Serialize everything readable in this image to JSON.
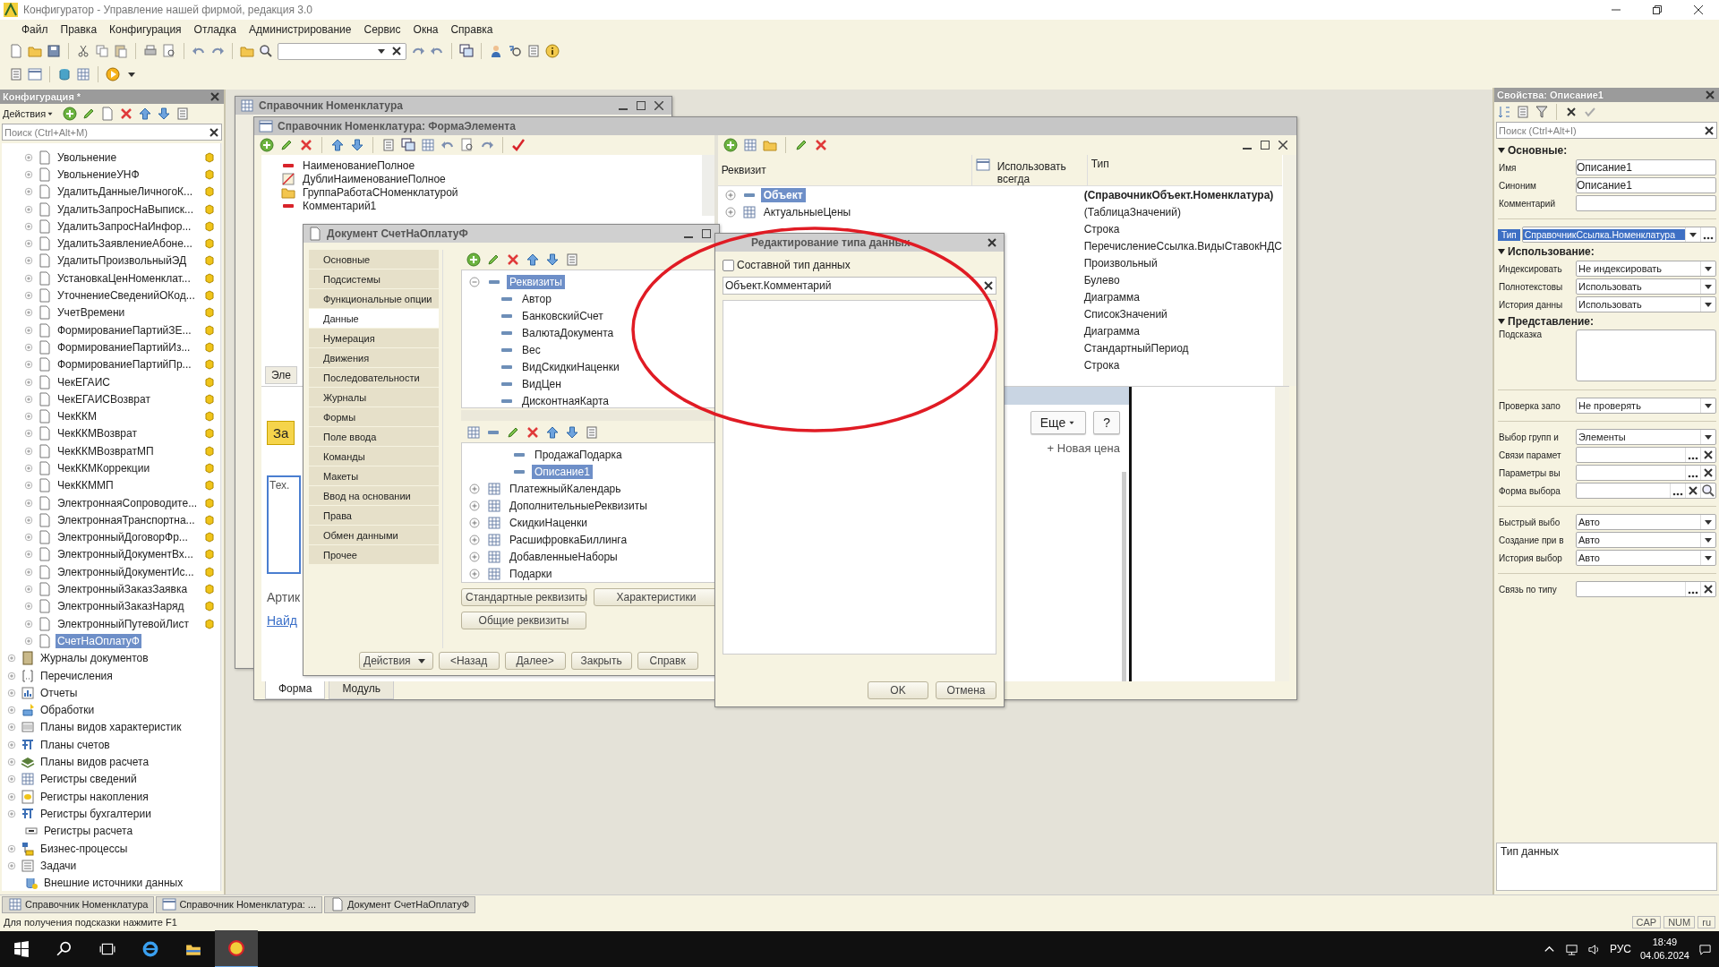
{
  "window": {
    "title": "Конфигуратор - Управление нашей фирмой, редакция 3.0"
  },
  "menu": [
    "Файл",
    "Правка",
    "Конфигурация",
    "Отладка",
    "Администрирование",
    "Сервис",
    "Окна",
    "Справка"
  ],
  "config": {
    "title": "Конфигурация *",
    "actions_label": "Действия",
    "search_placeholder": "Поиск (Ctrl+Alt+M)",
    "documents": [
      {
        "label": "Увольнение",
        "selected": false,
        "locked": true
      },
      {
        "label": "УвольнениеУНФ",
        "selected": false,
        "locked": true
      },
      {
        "label": "УдалитьДанныеЛичногоК...",
        "selected": false,
        "locked": true
      },
      {
        "label": "УдалитьЗапросНаВыписк...",
        "selected": false,
        "locked": true
      },
      {
        "label": "УдалитьЗапросНаИнфор...",
        "selected": false,
        "locked": true
      },
      {
        "label": "УдалитьЗаявлениеАбоне...",
        "selected": false,
        "locked": true
      },
      {
        "label": "УдалитьПроизвольныйЭД",
        "selected": false,
        "locked": true
      },
      {
        "label": "УстановкаЦенНоменклат...",
        "selected": false,
        "locked": true
      },
      {
        "label": "УточнениеСведенийОКод...",
        "selected": false,
        "locked": true
      },
      {
        "label": "УчетВремени",
        "selected": false,
        "locked": true
      },
      {
        "label": "ФормированиеПартийЗЕ...",
        "selected": false,
        "locked": true
      },
      {
        "label": "ФормированиеПартийИз...",
        "selected": false,
        "locked": true
      },
      {
        "label": "ФормированиеПартийПр...",
        "selected": false,
        "locked": true
      },
      {
        "label": "ЧекЕГАИС",
        "selected": false,
        "locked": true
      },
      {
        "label": "ЧекЕГАИСВозврат",
        "selected": false,
        "locked": true
      },
      {
        "label": "ЧекККМ",
        "selected": false,
        "locked": true
      },
      {
        "label": "ЧекККМВозврат",
        "selected": false,
        "locked": true
      },
      {
        "label": "ЧекККМВозвратМП",
        "selected": false,
        "locked": true
      },
      {
        "label": "ЧекККМКоррекции",
        "selected": false,
        "locked": true
      },
      {
        "label": "ЧекККММП",
        "selected": false,
        "locked": true
      },
      {
        "label": "ЭлектроннаяСопроводите...",
        "selected": false,
        "locked": true
      },
      {
        "label": "ЭлектроннаяТранспортна...",
        "selected": false,
        "locked": true
      },
      {
        "label": "ЭлектронныйДоговорФр...",
        "selected": false,
        "locked": true
      },
      {
        "label": "ЭлектронныйДокументВх...",
        "selected": false,
        "locked": true
      },
      {
        "label": "ЭлектронныйДокументИс...",
        "selected": false,
        "locked": true
      },
      {
        "label": "ЭлектронныйЗаказЗаявка",
        "selected": false,
        "locked": true
      },
      {
        "label": "ЭлектронныйЗаказНаряд",
        "selected": false,
        "locked": true
      },
      {
        "label": "ЭлектронныйПутевойЛист",
        "selected": false,
        "locked": true
      },
      {
        "label": "СчетНаОплатуФ",
        "selected": true,
        "locked": false
      }
    ],
    "sections": [
      {
        "label": "Журналы документов",
        "expandable": true
      },
      {
        "label": "Перечисления",
        "expandable": true
      },
      {
        "label": "Отчеты",
        "expandable": true
      },
      {
        "label": "Обработки",
        "expandable": true
      },
      {
        "label": "Планы видов характеристик",
        "expandable": true
      },
      {
        "label": "Планы счетов",
        "expandable": true
      },
      {
        "label": "Планы видов расчета",
        "expandable": true
      },
      {
        "label": "Регистры сведений",
        "expandable": true
      },
      {
        "label": "Регистры накопления",
        "expandable": true
      },
      {
        "label": "Регистры бухгалтерии",
        "expandable": true
      },
      {
        "label": "Регистры расчета",
        "expandable": false
      },
      {
        "label": "Бизнес-процессы",
        "expandable": true
      },
      {
        "label": "Задачи",
        "expandable": true
      },
      {
        "label": "Внешние источники данных",
        "expandable": false
      }
    ]
  },
  "catalog_window": {
    "title": "Справочник Номенклатура"
  },
  "element_form": {
    "title": "Справочник Номенклатура: ФормаЭлемента",
    "items": [
      {
        "label": "НаименованиеПолное",
        "kind": "attribute"
      },
      {
        "label": "ДублиНаименованиеПолное",
        "kind": "picture"
      },
      {
        "label": "ГруппаРаботаСНоменклатурой",
        "kind": "group"
      },
      {
        "label": "Комментарий1",
        "kind": "attribute"
      }
    ],
    "tab_label": "Эле",
    "attributes": {
      "columns": [
        "Реквизит",
        "Использовать всегда",
        "Тип"
      ],
      "rows": [
        {
          "name": "Объект",
          "kind": "attribute",
          "selected": true,
          "type": "(СправочникОбъект.Номенклатура)"
        },
        {
          "name": "АктуальныеЦены",
          "kind": "table",
          "selected": false,
          "type": "(ТаблицаЗначений)"
        },
        {
          "selected": false,
          "type": "Строка"
        },
        {
          "selected": false,
          "type": "ПеречислениеСсылка.ВидыСтавокНДС"
        },
        {
          "selected": false,
          "type": "Произвольный"
        },
        {
          "selected": false,
          "type": "Булево"
        },
        {
          "selected": false,
          "type": "Диаграмма"
        },
        {
          "selected": false,
          "type": "СписокЗначений"
        },
        {
          "selected": false,
          "type": "Диаграмма"
        },
        {
          "selected": false,
          "type": "СтандартныйПериод"
        },
        {
          "selected": false,
          "type": "Строка"
        }
      ]
    },
    "preview": {
      "button_label": "За",
      "field_label": "Тех.",
      "label": "Артик",
      "link": "Найд",
      "more_button": "Еще",
      "help_button": "?",
      "add_link": "+ Новая цена"
    },
    "bottom_tabs": [
      {
        "label": "Форма",
        "selected": true
      },
      {
        "label": "Модуль",
        "selected": false
      }
    ]
  },
  "document_window": {
    "title": "Документ СчетНаОплатуФ",
    "nav": [
      {
        "label": "Основные",
        "selected": false
      },
      {
        "label": "Подсистемы",
        "selected": false
      },
      {
        "label": "Функциональные опции",
        "selected": false
      },
      {
        "label": "Данные",
        "selected": true
      },
      {
        "label": "Нумерация",
        "selected": false
      },
      {
        "label": "Движения",
        "selected": false
      },
      {
        "label": "Последовательности",
        "selected": false
      },
      {
        "label": "Журналы",
        "selected": false
      },
      {
        "label": "Формы",
        "selected": false
      },
      {
        "label": "Поле ввода",
        "selected": false
      },
      {
        "label": "Команды",
        "selected": false
      },
      {
        "label": "Макеты",
        "selected": false
      },
      {
        "label": "Ввод на основании",
        "selected": false
      },
      {
        "label": "Права",
        "selected": false
      },
      {
        "label": "Обмен данными",
        "selected": false
      },
      {
        "label": "Прочее",
        "selected": false
      }
    ],
    "attributes_tree": [
      {
        "label": "Реквизиты",
        "selected": true,
        "expanded": true,
        "children": [
          {
            "label": "Автор"
          },
          {
            "label": "БанковскийСчет"
          },
          {
            "label": "ВалютаДокумента"
          },
          {
            "label": "Вес"
          },
          {
            "label": "ВидСкидкиНаценки"
          },
          {
            "label": "ВидЦен"
          },
          {
            "label": "ДисконтнаяКарта"
          }
        ]
      }
    ],
    "tables_tree": [
      {
        "label": "ПродажаПодарка",
        "kind": "attribute",
        "selected": false
      },
      {
        "label": "Описание1",
        "kind": "attribute",
        "selected": true
      },
      {
        "label": "ПлатежныйКалендарь",
        "kind": "table",
        "selected": false
      },
      {
        "label": "ДополнительныеРеквизиты",
        "kind": "table",
        "selected": false
      },
      {
        "label": "СкидкиНаценки",
        "kind": "table",
        "selected": false
      },
      {
        "label": "РасшифровкаБиллинга",
        "kind": "table",
        "selected": false
      },
      {
        "label": "ДобавленныеНаборы",
        "kind": "table",
        "selected": false
      },
      {
        "label": "Подарки",
        "kind": "table",
        "selected": false
      }
    ],
    "buttons": [
      "Стандартные реквизиты",
      "Характеристики",
      "Общие реквизиты"
    ],
    "footer_buttons": [
      {
        "label": "Действия",
        "kind": "menu"
      },
      {
        "label": "<Назад",
        "kind": "plain"
      },
      {
        "label": "Далее>",
        "kind": "plain"
      },
      {
        "label": "Закрыть",
        "kind": "plain"
      },
      {
        "label": "Справк",
        "kind": "plain"
      }
    ]
  },
  "type_dialog": {
    "title": "Редактирование типа данных",
    "composite": {
      "label": "Составной тип данных",
      "checked": false
    },
    "search": {
      "value": "Объект.Комментарий"
    },
    "buttons": [
      "OK",
      "Отмена"
    ]
  },
  "properties": {
    "title": "Свойства: Описание1",
    "search_placeholder": "Поиск (Ctrl+Alt+I)",
    "sections": [
      {
        "title": "Основные:",
        "rows": [
          {
            "label": "Имя",
            "kind": "field",
            "value": "Описание1"
          },
          {
            "label": "Синоним",
            "kind": "field",
            "value": "Описание1"
          },
          {
            "label": "Комментарий",
            "kind": "field"
          }
        ]
      },
      {
        "rows": [
          {
            "label": "Тип",
            "kind": "type",
            "value": "СправочникСсылка.Номенклатура"
          }
        ]
      },
      {
        "title": "Использование:",
        "rows": [
          {
            "label": "Индексировать",
            "kind": "select",
            "value": "Не индексировать"
          },
          {
            "label": "Полнотекстовы",
            "kind": "select",
            "value": "Использовать"
          },
          {
            "label": "История данны",
            "kind": "select",
            "value": "Использовать"
          }
        ]
      },
      {
        "title": "Представление:",
        "rows": [
          {
            "label": "Подсказка",
            "kind": "text"
          }
        ]
      },
      {
        "rows": [
          {
            "label": "Проверка запо",
            "kind": "select",
            "value": "Не проверять"
          }
        ]
      },
      {
        "rows": [
          {
            "label": "Выбор групп и",
            "kind": "select",
            "value": "Элементы"
          },
          {
            "label": "Связи парамет",
            "kind": "picker"
          },
          {
            "label": "Параметры вы",
            "kind": "picker"
          },
          {
            "label": "Форма выбора",
            "kind": "picker-search"
          }
        ]
      },
      {
        "rows": [
          {
            "label": "Быстрый выбо",
            "kind": "select",
            "value": "Авто"
          },
          {
            "label": "Создание при в",
            "kind": "select",
            "value": "Авто"
          },
          {
            "label": "История выбор",
            "kind": "select",
            "value": "Авто"
          }
        ]
      },
      {
        "rows": [
          {
            "label": "Связь по типу",
            "kind": "picker"
          }
        ]
      }
    ],
    "description": "Тип данных"
  },
  "window_tabs": [
    {
      "label": "Справочник Номенклатура",
      "kind": "catalog"
    },
    {
      "label": "Справочник Номенклатура: ...",
      "kind": "form"
    },
    {
      "label": "Документ СчетНаОплатуФ",
      "kind": "document"
    }
  ],
  "status_bar": {
    "hint": "Для получения подсказки нажмите F1",
    "indicators": [
      "CAP",
      "NUM",
      "ru"
    ]
  },
  "taskbar": {
    "language": "РУС",
    "time": "18:49",
    "date": "04.06.2024"
  }
}
